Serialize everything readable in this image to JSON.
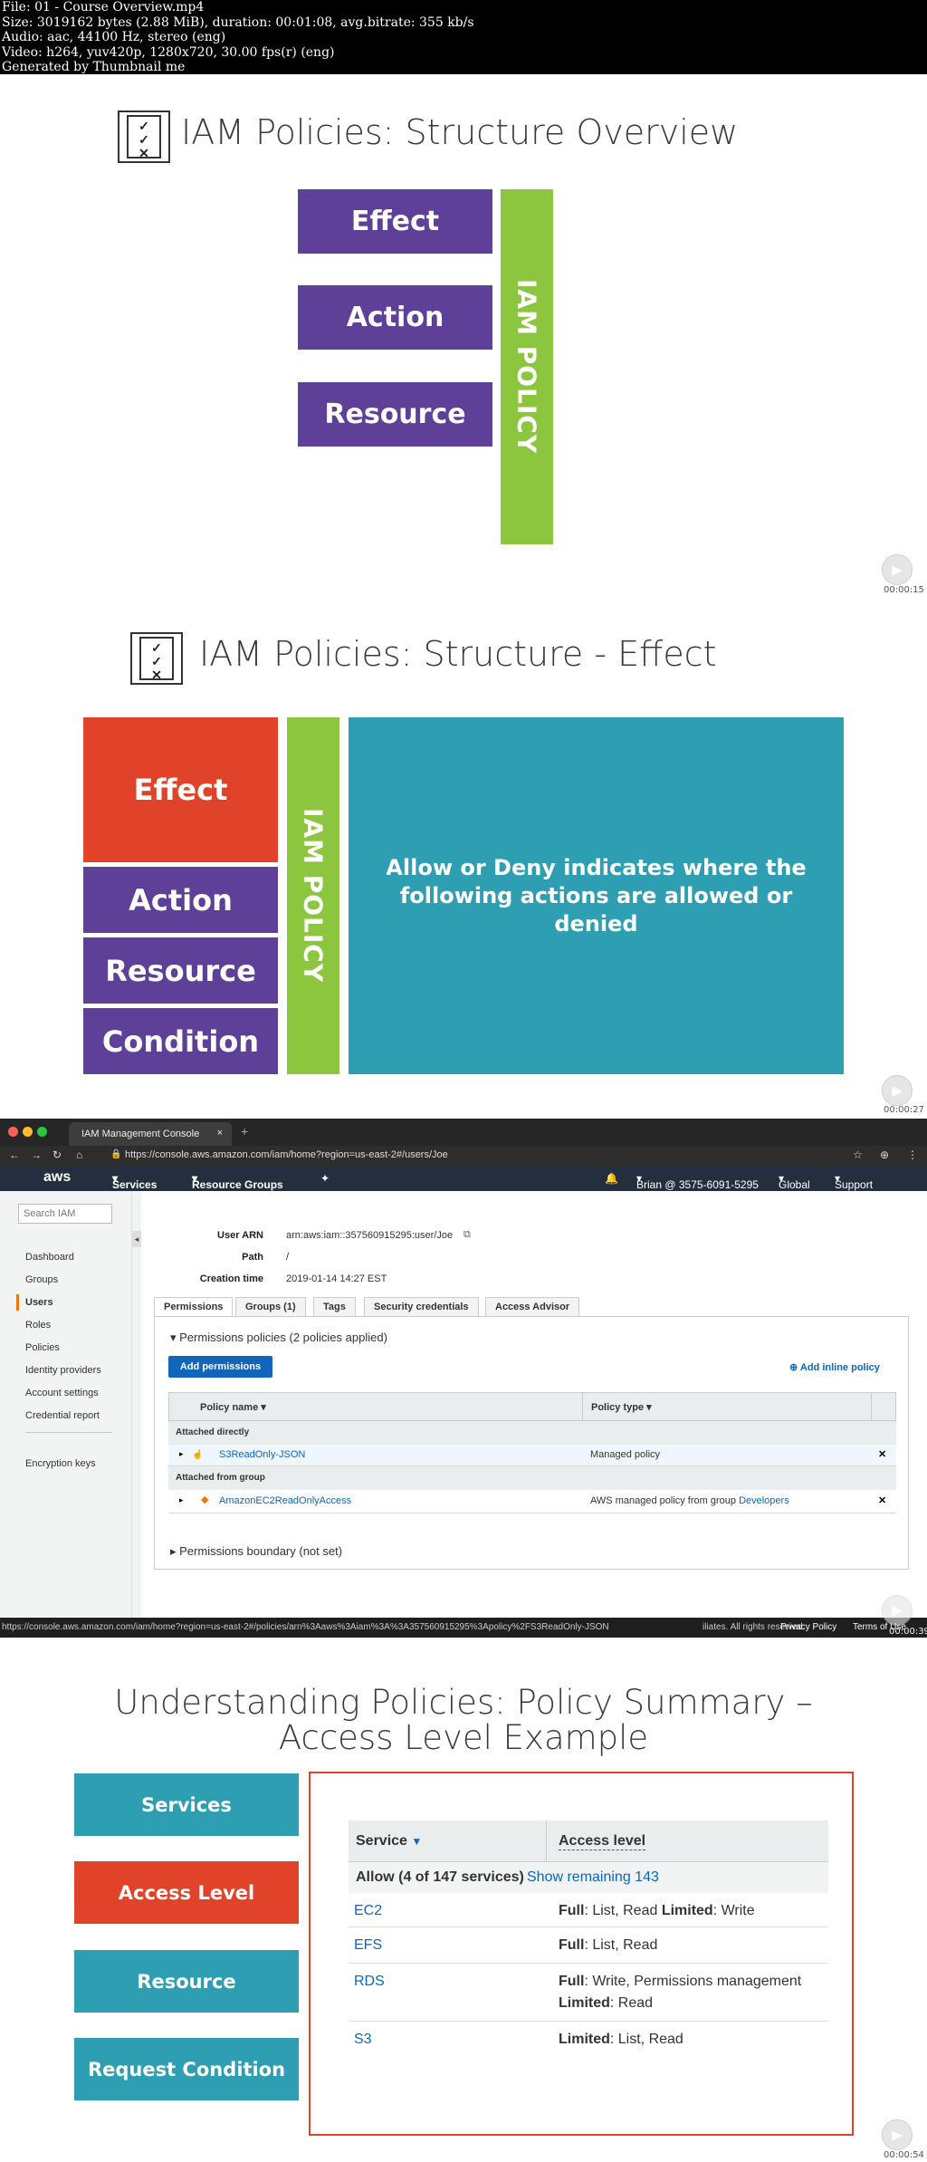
{
  "file_info": {
    "lines": [
      "File: 01 - Course Overview.mp4",
      "Size: 3019162 bytes (2.88 MiB), duration: 00:01:08, avg.bitrate: 355 kb/s",
      "Audio: aac, 44100 Hz, stereo (eng)",
      "Video: h264, yuv420p, 1280x720, 30.00 fps(r) (eng)",
      "Generated by Thumbnail me"
    ]
  },
  "frame1": {
    "title": "IAM Policies: Structure Overview",
    "blocks": [
      "Effect",
      "Action",
      "Resource"
    ],
    "side_label": "IAM POLICY",
    "timecode": "00:00:15"
  },
  "frame2": {
    "title": "IAM Policies: Structure - Effect",
    "blocks": [
      "Effect",
      "Action",
      "Resource",
      "Condition"
    ],
    "side_label": "IAM POLICY",
    "description": "Allow or Deny indicates where the following actions are allowed or denied",
    "timecode": "00:00:27"
  },
  "frame3": {
    "browser": {
      "tab_title": "IAM Management Console",
      "url": "https://console.aws.amazon.com/iam/home?region=us-east-2#/users/Joe",
      "status_url": "https://console.aws.amazon.com/iam/home?region=us-east-2#/policies/arn%3Aaws%3Aiam%3A%3A357560915295%3Apolicy%2FS3ReadOnly-JSON"
    },
    "aws_nav": {
      "logo": "aws",
      "services": "Services",
      "resource_groups": "Resource Groups",
      "account": "Brian @ 3575-6091-5295",
      "region": "Global",
      "support": "Support"
    },
    "sidebar": {
      "search_placeholder": "Search IAM",
      "items": [
        "Dashboard",
        "Groups",
        "Users",
        "Roles",
        "Policies",
        "Identity providers",
        "Account settings",
        "Credential report"
      ],
      "encryption": "Encryption keys",
      "active": "Users"
    },
    "summary": {
      "arn_label": "User ARN",
      "arn_value": "arn:aws:iam::357560915295:user/Joe",
      "path_label": "Path",
      "path_value": "/",
      "created_label": "Creation time",
      "created_value": "2019-01-14 14:27 EST"
    },
    "tabs": [
      "Permissions",
      "Groups (1)",
      "Tags",
      "Security credentials",
      "Access Advisor"
    ],
    "perm_policies_header": "Permissions policies (2 policies applied)",
    "add_permissions": "Add permissions",
    "add_inline": "Add inline policy",
    "table": {
      "col_name": "Policy name",
      "col_type": "Policy type",
      "group_direct": "Attached directly",
      "row1_name": "S3ReadOnly-JSON",
      "row1_type": "Managed policy",
      "group_from": "Attached from group",
      "row2_name": "AmazonEC2ReadOnlyAccess",
      "row2_type_prefix": "AWS managed policy from group",
      "row2_type_link": "Developers"
    },
    "boundary": "Permissions boundary (not set)",
    "footer_copyright": "iliates. All rights reserved.",
    "footer_privacy": "Privacy Policy",
    "footer_terms": "Terms of Use",
    "timecode": "00:00:39"
  },
  "frame4": {
    "title_line1": "Understanding Policies: Policy Summary –",
    "title_line2": "Access Level Example",
    "left_blocks": [
      "Services",
      "Access Level",
      "Resource",
      "Request Condition"
    ],
    "table": {
      "col_service": "Service",
      "col_access": "Access level",
      "allow_text": "Allow (4 of 147 services)",
      "show_remaining": "Show remaining 143",
      "rows": [
        {
          "service": "EC2",
          "l1_bold": "Full",
          "l1_rest": ": List, Read ",
          "l1_bold2": "Limited",
          "l1_rest2": ": Write"
        },
        {
          "service": "EFS",
          "l1_bold": "Full",
          "l1_rest": ": List, Read",
          "l1_bold2": "",
          "l1_rest2": ""
        },
        {
          "service": "RDS",
          "l1_bold": "Full",
          "l1_rest": ": Write, Permissions management",
          "l1_bold2": "",
          "l1_rest2": "",
          "l2_bold": "Limited",
          "l2_rest": ": Read"
        },
        {
          "service": "S3",
          "l1_bold": "Limited",
          "l1_rest": ": List, Read",
          "l1_bold2": "",
          "l1_rest2": ""
        }
      ]
    },
    "timecode": "00:00:54"
  },
  "colors": {
    "purple": "#5e4099",
    "green": "#8cc63f",
    "orange": "#e0432a",
    "teal": "#2e9eb2",
    "aws_nav": "#232f3e",
    "button_blue": "#1166bb"
  }
}
